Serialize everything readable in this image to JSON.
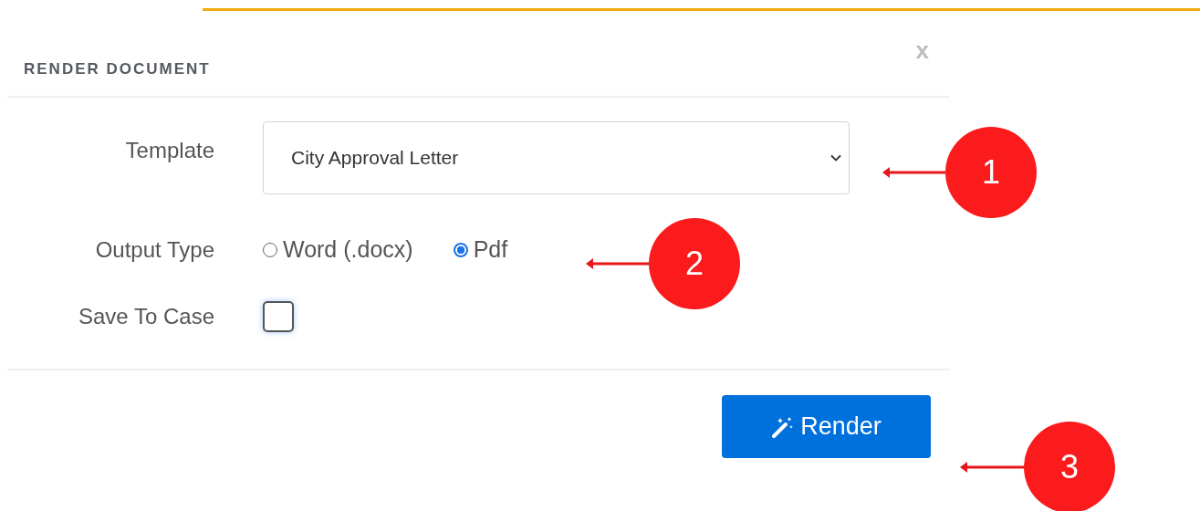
{
  "dialog": {
    "title": "RENDER DOCUMENT",
    "close": "x"
  },
  "template": {
    "label": "Template",
    "value": "City Approval Letter"
  },
  "output_type": {
    "label": "Output Type",
    "options": [
      {
        "label": "Word (.docx)",
        "selected": false
      },
      {
        "label": "Pdf",
        "selected": true
      }
    ]
  },
  "save_to_case": {
    "label": "Save To Case",
    "checked": false
  },
  "render_button": {
    "label": "Render"
  },
  "callouts": [
    {
      "label": "1"
    },
    {
      "label": "2"
    },
    {
      "label": "3"
    }
  ]
}
